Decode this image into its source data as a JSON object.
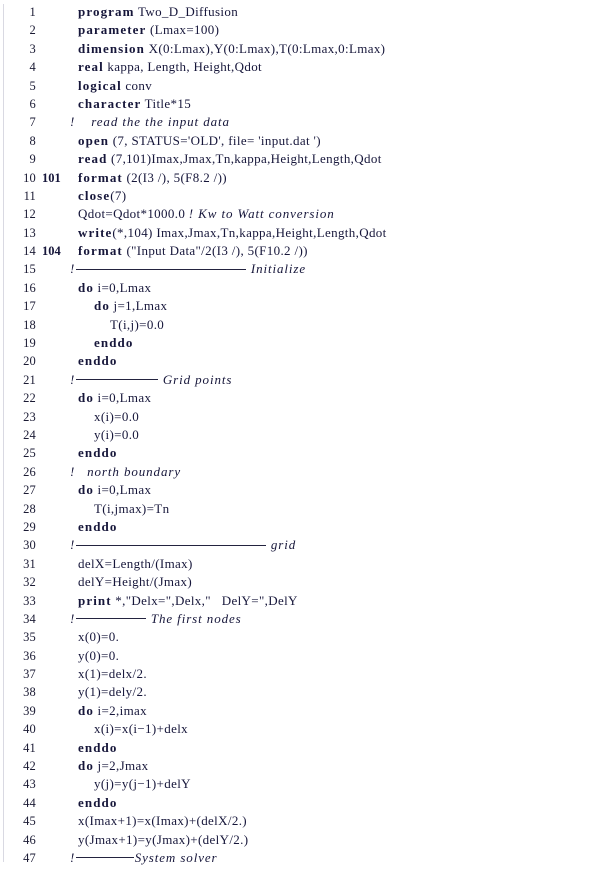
{
  "document": {
    "kind": "source-code-listing",
    "language": "Fortran",
    "program_name": "Two_D_Diffusion",
    "font_colors": {
      "text": "#16163a",
      "line_number": "#1a1a33",
      "left_rule": "#d9d9e2"
    },
    "total_lines": 47
  },
  "lines": [
    {
      "n": "1",
      "label": "",
      "code": "program Two_D_Diffusion",
      "kw": "program",
      "rest": " Two_D_Diffusion",
      "type": "code"
    },
    {
      "n": "2",
      "label": "",
      "code": "parameter (Lmax=100)",
      "kw": "parameter",
      "rest": " (Lmax=100)",
      "type": "code"
    },
    {
      "n": "3",
      "label": "",
      "code": "dimension X(0:Lmax),Y(0:Lmax),T(0:Lmax,0:Lmax)",
      "kw": "dimension",
      "rest": " X(0:Lmax),Y(0:Lmax),T(0:Lmax,0:Lmax)",
      "type": "code"
    },
    {
      "n": "4",
      "label": "",
      "code": "real kappa, Length, Height,Qdot",
      "kw": "real",
      "rest": " kappa, Length, Height,Qdot",
      "type": "code"
    },
    {
      "n": "5",
      "label": "",
      "code": "logical conv",
      "kw": "logical",
      "rest": " conv",
      "type": "code"
    },
    {
      "n": "6",
      "label": "",
      "code": "character Title*15",
      "kw": "character",
      "rest": " Title*15",
      "type": "code"
    },
    {
      "n": "7",
      "label": "",
      "code": "!    read the the input data",
      "comment": "!",
      "comment_text": "    read the the input data",
      "type": "comment-inline"
    },
    {
      "n": "8",
      "label": "",
      "code": "open (7, STATUS='OLD', file= 'input.dat ')",
      "kw": "open",
      "rest": " (7, STATUS='OLD', file= 'input.dat ')",
      "type": "code"
    },
    {
      "n": "9",
      "label": "",
      "code": "read (7,101)Imax,Jmax,Tn,kappa,Height,Length,Qdot",
      "kw": "read",
      "rest": " (7,101)Imax,Jmax,Tn,kappa,Height,Length,Qdot",
      "type": "code"
    },
    {
      "n": "10",
      "label": "101",
      "code": "format (2(I3 /), 5(F8.2 /))",
      "kw": "format",
      "rest": " (2(I3 /), 5(F8.2 /))",
      "type": "code"
    },
    {
      "n": "11",
      "label": "",
      "code": "close(7)",
      "kw": "close",
      "rest": "(7)",
      "type": "code"
    },
    {
      "n": "12",
      "label": "",
      "code": "Qdot=Qdot*1000.0 ! Kw to Watt conversion",
      "plain": "Qdot=Qdot*1000.0 ",
      "comment_text": "! Kw to Watt conversion",
      "type": "code-trailing-comment"
    },
    {
      "n": "13",
      "label": "",
      "code": "write(*,104) Imax,Jmax,Tn,kappa,Height,Length,Qdot",
      "kw": "write",
      "rest": "(*,104) Imax,Jmax,Tn,kappa,Height,Length,Qdot",
      "type": "code"
    },
    {
      "n": "14",
      "label": "104",
      "code": "format (\"Input Data\"/2(I3 /), 5(F10.2 /))",
      "kw": "format",
      "rest": " (\"Input Data\"/2(I3 /), 5(F10.2 /))",
      "type": "code"
    },
    {
      "n": "15",
      "label": "",
      "code": "!----------------------- Initialize",
      "comment": "!",
      "rule_width": 170,
      "comment_text": " Initialize",
      "type": "section"
    },
    {
      "n": "16",
      "label": "",
      "code": "do i=0,Lmax",
      "kw": "do",
      "rest": " i=0,Lmax",
      "indent": 0,
      "type": "code"
    },
    {
      "n": "17",
      "label": "",
      "code": "do j=1,Lmax",
      "kw": "do",
      "rest": " j=1,Lmax",
      "indent": 1,
      "type": "code"
    },
    {
      "n": "18",
      "label": "",
      "code": "T(i,j)=0.0",
      "plain": "T(i,j)=0.0",
      "indent": 2,
      "type": "code"
    },
    {
      "n": "19",
      "label": "",
      "code": "enddo",
      "kw": "enddo",
      "rest": "",
      "indent": 1,
      "type": "code"
    },
    {
      "n": "20",
      "label": "",
      "code": "enddo",
      "kw": "enddo",
      "rest": "",
      "indent": 0,
      "type": "code"
    },
    {
      "n": "21",
      "label": "",
      "code": "!---------- Grid points",
      "comment": "!",
      "rule_width": 82,
      "comment_text": " Grid points",
      "type": "section"
    },
    {
      "n": "22",
      "label": "",
      "code": "do i=0,Lmax",
      "kw": "do",
      "rest": " i=0,Lmax",
      "indent": 0,
      "type": "code"
    },
    {
      "n": "23",
      "label": "",
      "code": "x(i)=0.0",
      "plain": "x(i)=0.0",
      "indent": 1,
      "type": "code"
    },
    {
      "n": "24",
      "label": "",
      "code": "y(i)=0.0",
      "plain": "y(i)=0.0",
      "indent": 1,
      "type": "code"
    },
    {
      "n": "25",
      "label": "",
      "code": "enddo",
      "kw": "enddo",
      "rest": "",
      "indent": 0,
      "type": "code"
    },
    {
      "n": "26",
      "label": "",
      "code": "!   north boundary",
      "comment": "!",
      "comment_text": "   north boundary",
      "type": "comment-inline"
    },
    {
      "n": "27",
      "label": "",
      "code": "do i=0,Lmax",
      "kw": "do",
      "rest": " i=0,Lmax",
      "indent": 0,
      "type": "code"
    },
    {
      "n": "28",
      "label": "",
      "code": "T(i,jmax)=Tn",
      "plain": "T(i,jmax)=Tn",
      "indent": 1,
      "type": "code"
    },
    {
      "n": "29",
      "label": "",
      "code": "enddo",
      "kw": "enddo",
      "rest": "",
      "indent": 0,
      "type": "code"
    },
    {
      "n": "30",
      "label": "",
      "code": "!------------------------- grid",
      "comment": "!",
      "rule_width": 190,
      "comment_text": " grid",
      "type": "section"
    },
    {
      "n": "31",
      "label": "",
      "code": "delX=Length/(Imax)",
      "plain": "delX=Length/(Imax)",
      "indent": 0,
      "type": "code"
    },
    {
      "n": "32",
      "label": "",
      "code": "delY=Height/(Jmax)",
      "plain": "delY=Height/(Jmax)",
      "indent": 0,
      "type": "code"
    },
    {
      "n": "33",
      "label": "",
      "code": "print *,\"Delx=\",Delx,\"  DelY=\",DelY",
      "kw": "print",
      "rest": " *,\"Delx=\",Delx,\"   DelY=\",DelY",
      "indent": 0,
      "type": "code"
    },
    {
      "n": "34",
      "label": "",
      "code": "!--------- The first nodes",
      "comment": "!",
      "rule_width": 70,
      "comment_text": " The first nodes",
      "type": "section"
    },
    {
      "n": "35",
      "label": "",
      "code": "x(0)=0.",
      "plain": "x(0)=0.",
      "indent": 0,
      "type": "code"
    },
    {
      "n": "36",
      "label": "",
      "code": "y(0)=0.",
      "plain": "y(0)=0.",
      "indent": 0,
      "type": "code"
    },
    {
      "n": "37",
      "label": "",
      "code": "x(1)=delx/2.",
      "plain": "x(1)=delx/2.",
      "indent": 0,
      "type": "code"
    },
    {
      "n": "38",
      "label": "",
      "code": "y(1)=dely/2.",
      "plain": "y(1)=dely/2.",
      "indent": 0,
      "type": "code"
    },
    {
      "n": "39",
      "label": "",
      "code": "do i=2,imax",
      "kw": "do",
      "rest": " i=2,imax",
      "indent": 0,
      "type": "code"
    },
    {
      "n": "40",
      "label": "",
      "code": "x(i)=x(i-1)+delx",
      "plain": "x(i)=x(i−1)+delx",
      "indent": 1,
      "type": "code"
    },
    {
      "n": "41",
      "label": "",
      "code": "enddo",
      "kw": "enddo",
      "rest": "",
      "indent": 0,
      "type": "code"
    },
    {
      "n": "42",
      "label": "",
      "code": "do j=2,Jmax",
      "kw": "do",
      "rest": " j=2,Jmax",
      "indent": 0,
      "type": "code"
    },
    {
      "n": "43",
      "label": "",
      "code": "y(j)=y(j-1)+delY",
      "plain": "y(j)=y(j−1)+delY",
      "indent": 1,
      "type": "code"
    },
    {
      "n": "44",
      "label": "",
      "code": "enddo",
      "kw": "enddo",
      "rest": "",
      "indent": 0,
      "type": "code"
    },
    {
      "n": "45",
      "label": "",
      "code": "x(Imax+1)=x(Imax)+(delX/2.)",
      "plain": "x(Imax+1)=x(Imax)+(delX/2.)",
      "indent": 0,
      "type": "code"
    },
    {
      "n": "46",
      "label": "",
      "code": "y(Jmax+1)=y(Jmax)+(delY/2.)",
      "plain": "y(Jmax+1)=y(Jmax)+(delY/2.)",
      "indent": 0,
      "type": "code"
    },
    {
      "n": "47",
      "label": "",
      "code": "!-------System solver",
      "comment": "!",
      "rule_width": 58,
      "comment_text": "System solver",
      "type": "section"
    }
  ]
}
